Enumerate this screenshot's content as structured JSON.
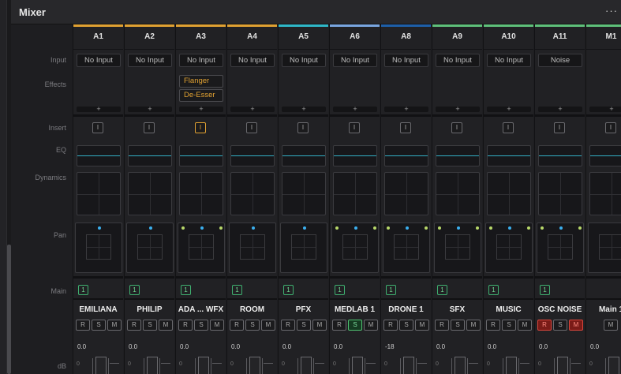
{
  "window": {
    "title": "Mixer",
    "menu_label": "···"
  },
  "row_labels": {
    "input": "Input",
    "effects": "Effects",
    "insert": "Insert",
    "eq": "EQ",
    "dynamics": "Dynamics",
    "pan": "Pan",
    "main": "Main",
    "db": "dB"
  },
  "channels": [
    {
      "id": "A1",
      "accent": "#e0a132",
      "input": "No Input",
      "effects": [],
      "insert": "I",
      "insert_on": false,
      "main": "1",
      "track": "EMILIANA",
      "rsm": [
        "R",
        "S",
        "M"
      ],
      "r_on": false,
      "s_on": false,
      "m_on": false,
      "volume": "0.0",
      "fader_tick": "0",
      "pan_dots": [
        "blue"
      ]
    },
    {
      "id": "A2",
      "accent": "#e0a132",
      "input": "No Input",
      "effects": [],
      "insert": "I",
      "insert_on": false,
      "main": "1",
      "track": "PHILIP",
      "rsm": [
        "R",
        "S",
        "M"
      ],
      "r_on": false,
      "s_on": false,
      "m_on": false,
      "volume": "0.0",
      "fader_tick": "0",
      "pan_dots": [
        "blue"
      ]
    },
    {
      "id": "A3",
      "accent": "#e0a132",
      "input": "No Input",
      "effects": [
        "Flanger",
        "De-Esser"
      ],
      "insert": "I",
      "insert_on": true,
      "main": "1",
      "track": "ADA ... WFX",
      "rsm": [
        "R",
        "S",
        "M"
      ],
      "r_on": false,
      "s_on": false,
      "m_on": false,
      "volume": "0.0",
      "fader_tick": "0",
      "pan_dots": [
        "green",
        "blue",
        "green"
      ]
    },
    {
      "id": "A4",
      "accent": "#e0a132",
      "input": "No Input",
      "effects": [],
      "insert": "I",
      "insert_on": false,
      "main": "1",
      "track": "ROOM",
      "rsm": [
        "R",
        "S",
        "M"
      ],
      "r_on": false,
      "s_on": false,
      "m_on": false,
      "volume": "0.0",
      "fader_tick": "0",
      "pan_dots": [
        "blue"
      ]
    },
    {
      "id": "A5",
      "accent": "#2fb8c8",
      "input": "No Input",
      "effects": [],
      "insert": "I",
      "insert_on": false,
      "main": "1",
      "track": "PFX",
      "rsm": [
        "R",
        "S",
        "M"
      ],
      "r_on": false,
      "s_on": false,
      "m_on": false,
      "volume": "0.0",
      "fader_tick": "0",
      "pan_dots": [
        "blue"
      ]
    },
    {
      "id": "A6",
      "accent": "#7aa6e0",
      "input": "No Input",
      "effects": [],
      "insert": "I",
      "insert_on": false,
      "main": "1",
      "track": "MEDLAB 1",
      "rsm": [
        "R",
        "S",
        "M"
      ],
      "r_on": false,
      "s_on": true,
      "m_on": false,
      "volume": "0.0",
      "fader_tick": "0",
      "pan_dots": [
        "green",
        "blue",
        "green"
      ]
    },
    {
      "id": "A8",
      "accent": "#1e5fa8",
      "input": "No Input",
      "effects": [],
      "insert": "I",
      "insert_on": false,
      "main": "1",
      "track": "DRONE 1",
      "rsm": [
        "R",
        "S",
        "M"
      ],
      "r_on": false,
      "s_on": false,
      "m_on": false,
      "volume": "-18",
      "fader_tick": "0",
      "pan_dots": [
        "green",
        "blue",
        "green"
      ]
    },
    {
      "id": "A9",
      "accent": "#5fc07a",
      "input": "No Input",
      "effects": [],
      "insert": "I",
      "insert_on": false,
      "main": "1",
      "track": "SFX",
      "rsm": [
        "R",
        "S",
        "M"
      ],
      "r_on": false,
      "s_on": false,
      "m_on": false,
      "volume": "0.0",
      "fader_tick": "0",
      "pan_dots": [
        "green",
        "blue",
        "green"
      ]
    },
    {
      "id": "A10",
      "accent": "#5fc07a",
      "input": "No Input",
      "effects": [],
      "insert": "I",
      "insert_on": false,
      "main": "1",
      "track": "MUSIC",
      "rsm": [
        "R",
        "S",
        "M"
      ],
      "r_on": false,
      "s_on": false,
      "m_on": false,
      "volume": "0.0",
      "fader_tick": "0",
      "pan_dots": [
        "green",
        "blue",
        "green"
      ]
    },
    {
      "id": "A11",
      "accent": "#5fc07a",
      "input": "Noise",
      "effects": [],
      "insert": "I",
      "insert_on": false,
      "main": "1",
      "track": "OSC NOISE",
      "rsm": [
        "R",
        "S",
        "M"
      ],
      "r_on": true,
      "s_on": false,
      "m_on": true,
      "volume": "0.0",
      "fader_tick": "0",
      "pan_dots": [
        "green",
        "blue",
        "green"
      ]
    },
    {
      "id": "M1",
      "accent": "#5fc07a",
      "input": "",
      "effects": [],
      "insert": "I",
      "insert_on": false,
      "main": "",
      "track": "Main 1",
      "rsm": [
        "M"
      ],
      "r_on": false,
      "s_on": false,
      "m_on": false,
      "volume": "0.0",
      "fader_tick": "0",
      "pan_dots": []
    }
  ]
}
